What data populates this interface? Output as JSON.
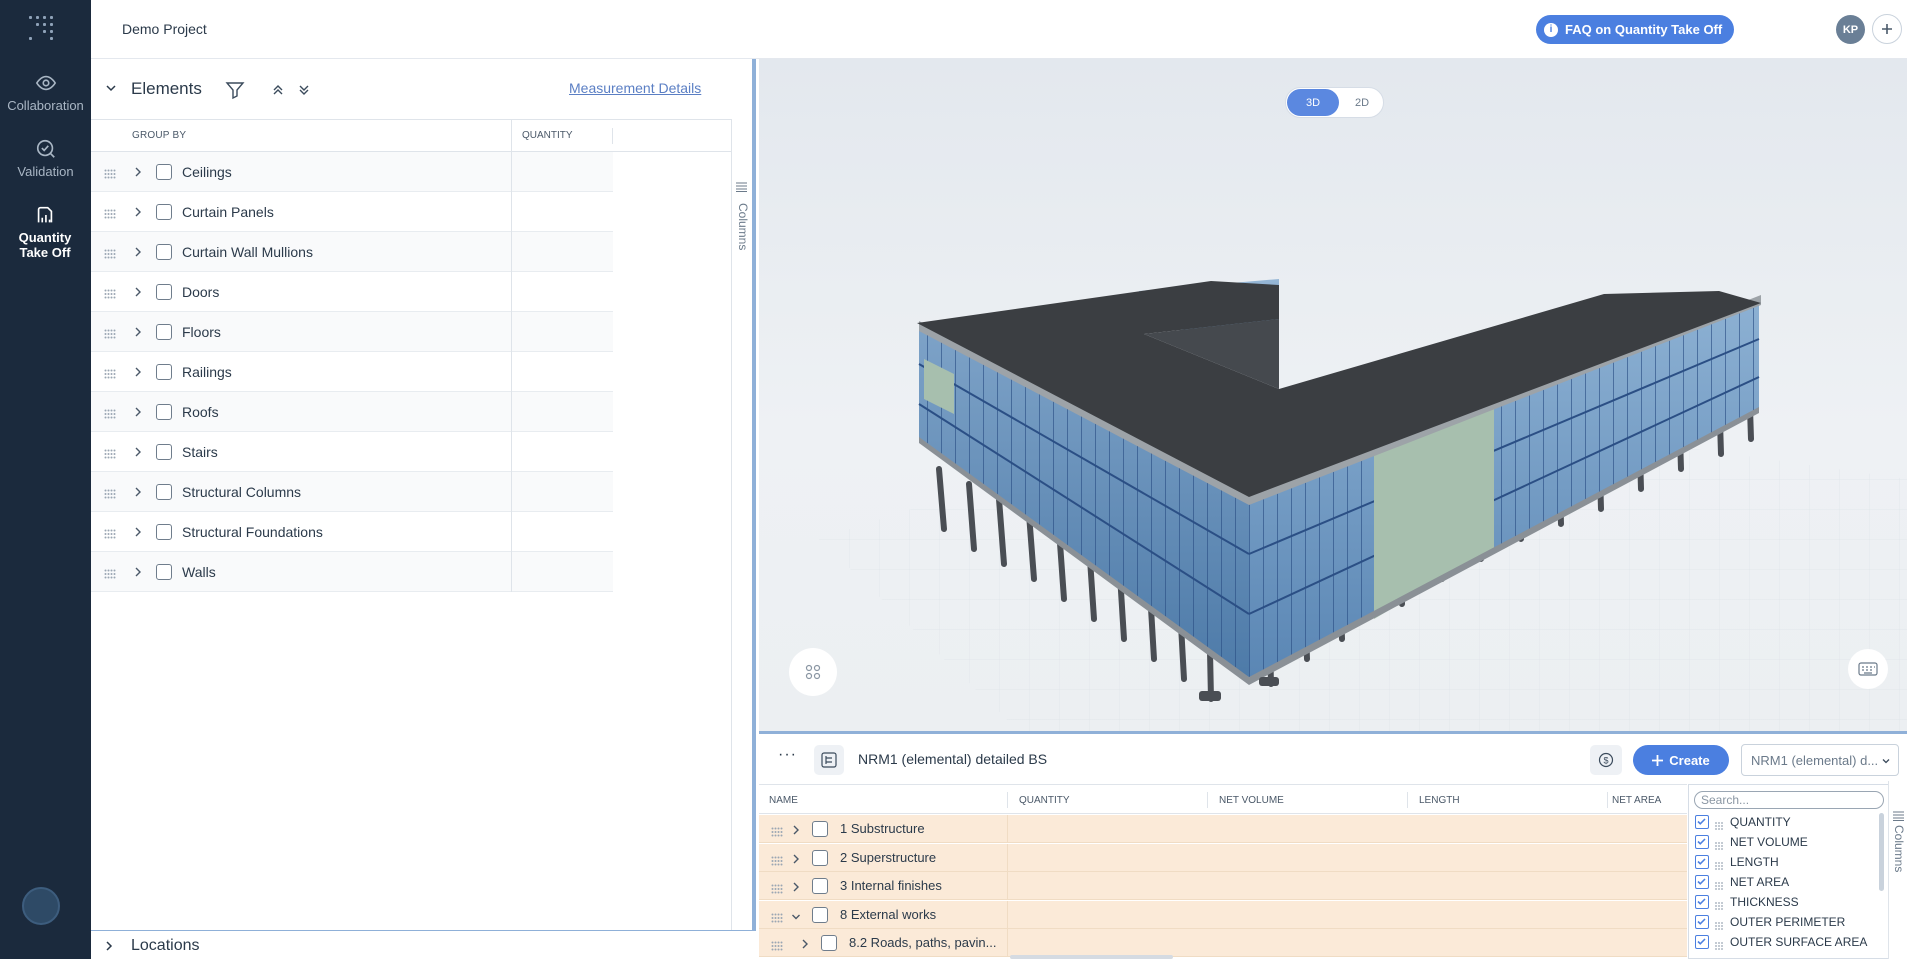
{
  "app": {
    "project_name": "Demo Project",
    "faq_label": "FAQ on Quantity Take Off",
    "user_initials": "KP"
  },
  "rail": {
    "items": [
      {
        "label": "Collaboration",
        "icon": "eye-icon"
      },
      {
        "label": "Validation",
        "icon": "check-circle-icon"
      },
      {
        "label": "Quantity Take Off",
        "icon": "qto-icon",
        "active": true
      }
    ]
  },
  "elements_panel": {
    "title": "Elements",
    "measurement_link": "Measurement Details",
    "columns": [
      "GROUP BY",
      "QUANTITY"
    ],
    "columns_tab": "Columns",
    "rows": [
      "Ceilings",
      "Curtain Panels",
      "Curtain Wall Mullions",
      "Doors",
      "Floors",
      "Railings",
      "Roofs",
      "Stairs",
      "Structural Columns",
      "Structural Foundations",
      "Walls"
    ]
  },
  "locations_panel": {
    "title": "Locations"
  },
  "viewer": {
    "mode_3d": "3D",
    "mode_2d": "2D",
    "active_mode": "3D"
  },
  "boq": {
    "more_label": "···",
    "name": "NRM1 (elemental) detailed BS",
    "create_label": "Create",
    "select_value": "NRM1 (elemental) d...",
    "columns": [
      "NAME",
      "QUANTITY",
      "NET VOLUME",
      "LENGTH",
      "NET AREA"
    ],
    "rows": [
      {
        "label": "1 Substructure",
        "expanded": false,
        "level": 0
      },
      {
        "label": "2 Superstructure",
        "expanded": false,
        "level": 0
      },
      {
        "label": "3 Internal finishes",
        "expanded": false,
        "level": 0
      },
      {
        "label": "8 External works",
        "expanded": true,
        "level": 0
      },
      {
        "label": "8.2 Roads, paths, pavin...",
        "expanded": false,
        "level": 1
      }
    ],
    "column_chooser": {
      "search_placeholder": "Search...",
      "items": [
        "QUANTITY",
        "NET VOLUME",
        "LENGTH",
        "NET AREA",
        "THICKNESS",
        "OUTER PERIMETER",
        "OUTER SURFACE AREA"
      ]
    },
    "columns_tab": "Columns"
  },
  "colors": {
    "rail_bg": "#1b2a3d",
    "accent": "#4b7fe0",
    "boq_row_bg": "#fbead8"
  }
}
